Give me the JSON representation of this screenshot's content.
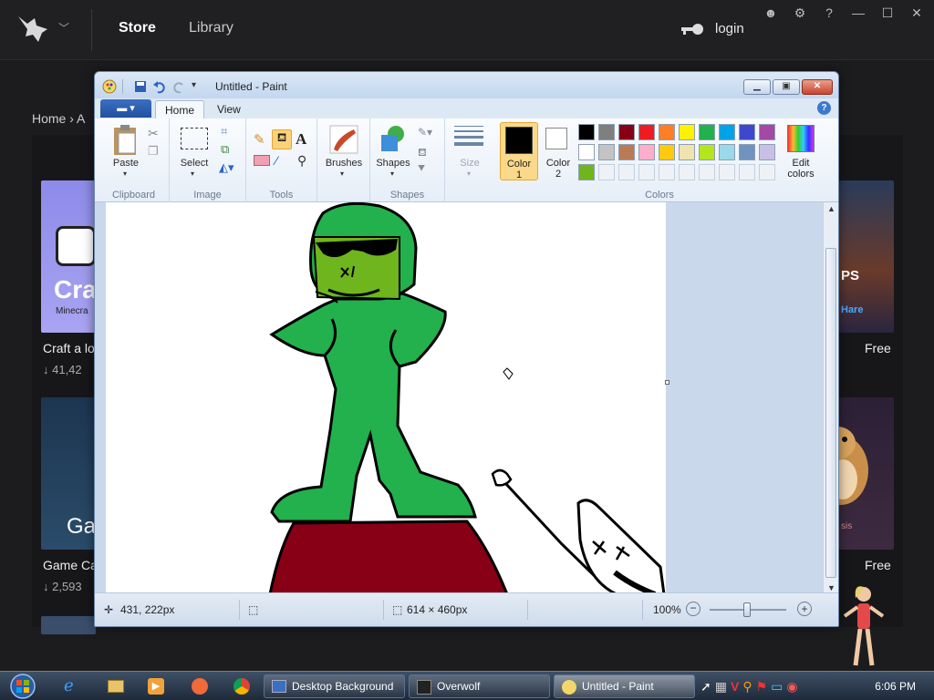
{
  "overwolf": {
    "nav_store": "Store",
    "nav_library": "Library",
    "login": "login",
    "breadcrumb": "Home  ›  A",
    "tiles": [
      {
        "title": "Craft a lo",
        "sub": "↓ 41,42",
        "logo_text": "Cra",
        "logo_sub": "Minecra"
      },
      {
        "title": "Game Ca",
        "sub": "↓ 2,593",
        "logo_text": "Ga"
      }
    ],
    "right_free_1": "Free",
    "right_free_2": "Free",
    "right_tile_text": "PS",
    "right_tile_sub": "Hare",
    "right_tile_sub2": "sis"
  },
  "paint": {
    "title": "Untitled - Paint",
    "tabs": {
      "home": "Home",
      "view": "View"
    },
    "groups": {
      "clipboard": "Clipboard",
      "image": "Image",
      "tools": "Tools",
      "shapes": "Shapes",
      "colors": "Colors"
    },
    "buttons": {
      "paste": "Paste",
      "select": "Select",
      "brushes": "Brushes",
      "shapes": "Shapes",
      "size": "Size",
      "color1_a": "Color",
      "color1_b": "1",
      "color2_a": "Color",
      "color2_b": "2",
      "edit_a": "Edit",
      "edit_b": "colors"
    },
    "color1": "#000000",
    "color2": "#ffffff",
    "palette": [
      "#000000",
      "#7f7f7f",
      "#880015",
      "#ed1c24",
      "#ff7f27",
      "#fff200",
      "#22b14c",
      "#00a2e8",
      "#3f48cc",
      "#a349a4",
      "#ffffff",
      "#c3c3c3",
      "#b97a57",
      "#ffaec9",
      "#ffc90e",
      "#efe4b0",
      "#b5e61d",
      "#99d9ea",
      "#7092be",
      "#c8bfe7",
      "#6fb51e"
    ],
    "status": {
      "cursor": "431, 222px",
      "size": "614 × 460px",
      "zoom": "100%"
    }
  },
  "taskbar": {
    "tasks": [
      "Desktop Background",
      "Overwolf",
      "Untitled - Paint"
    ],
    "clock": "6:06 PM"
  }
}
